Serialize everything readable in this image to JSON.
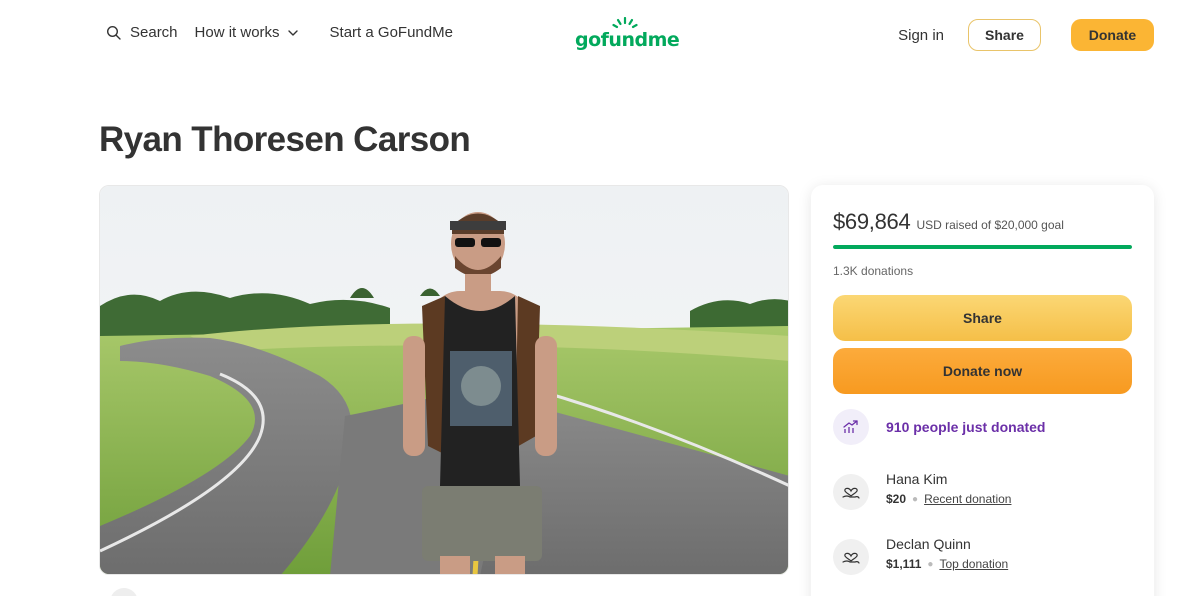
{
  "header": {
    "search_label": "Search",
    "how_it_works_label": "How it works",
    "start_label": "Start a GoFundMe",
    "logo_text": "gofundme",
    "signin_label": "Sign in",
    "share_label": "Share",
    "donate_label": "Donate"
  },
  "campaign": {
    "title": "Ryan Thoresen Carson"
  },
  "card": {
    "amount_raised": "$69,864",
    "goal_text": "USD raised of $20,000 goal",
    "progress_fraction": 1.0,
    "donations_count": "1.3K donations",
    "share_button": "Share",
    "donate_button": "Donate now",
    "activity_text": "910 people just donated",
    "donors": [
      {
        "name": "Hana Kim",
        "amount": "$20",
        "tag": "Recent donation"
      },
      {
        "name": "Declan Quinn",
        "amount": "$1,111",
        "tag": "Top donation"
      }
    ]
  },
  "colors": {
    "brand_green": "#02a95c",
    "accent_yellow": "#fbb534",
    "donate_orange": "#f79a20",
    "activity_purple": "#6b2fa8"
  },
  "icons": [
    "search-icon",
    "chevron-down-icon",
    "trending-up-icon",
    "heart-hand-icon"
  ]
}
